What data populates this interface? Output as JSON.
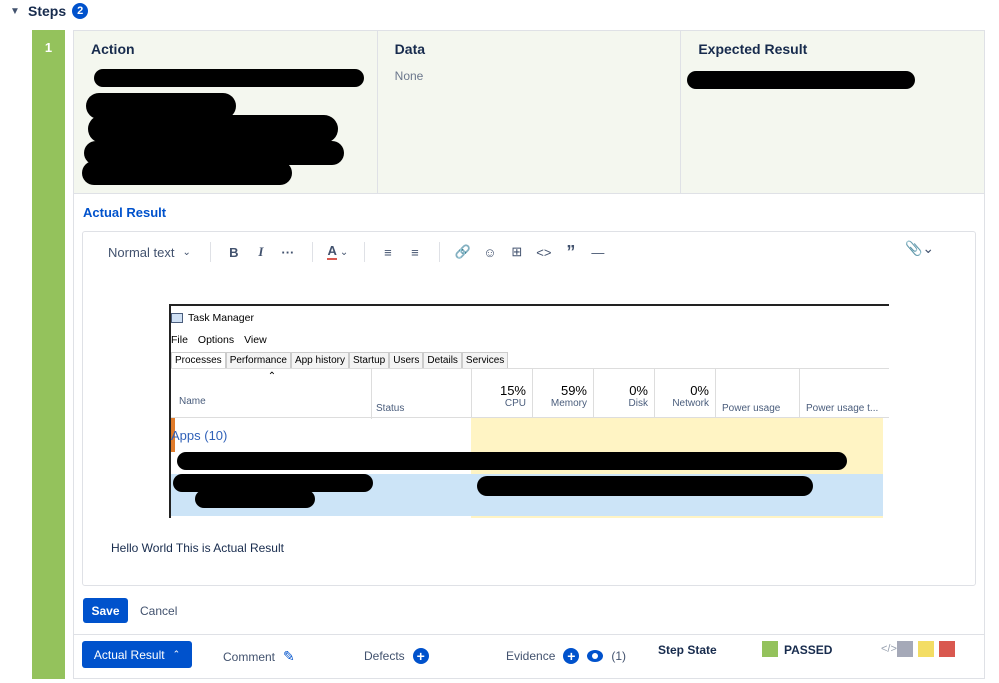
{
  "section": {
    "title": "Steps",
    "count": "2",
    "chevron_icon": "chevron-down-icon"
  },
  "step": {
    "number": "1",
    "columns": [
      {
        "header": "Action",
        "value": ""
      },
      {
        "header": "Data",
        "value": "None"
      },
      {
        "header": "Expected Result",
        "value": ""
      }
    ]
  },
  "actual_result": {
    "title": "Actual Result",
    "toolbar": {
      "text_style": "Normal text",
      "icons": [
        "bold-icon",
        "italic-icon",
        "more-formatting-icon",
        "text-color-icon",
        "bullet-list-icon",
        "numbered-list-icon",
        "link-icon",
        "emoji-icon",
        "table-icon",
        "code-icon",
        "quote-icon",
        "divider-icon",
        "attachment-icon"
      ],
      "bold_glyph": "B",
      "italic_glyph": "I",
      "more_glyph": "···",
      "text_color_glyph": "A"
    },
    "embedded_screenshot": {
      "window_title": "Task Manager",
      "menu": [
        "File",
        "Options",
        "View"
      ],
      "tabs": [
        "Processes",
        "Performance",
        "App history",
        "Startup",
        "Users",
        "Details",
        "Services"
      ],
      "columns": [
        {
          "label": "Name",
          "pct": ""
        },
        {
          "label": "Status",
          "pct": ""
        },
        {
          "label": "CPU",
          "pct": "15%"
        },
        {
          "label": "Memory",
          "pct": "59%"
        },
        {
          "label": "Disk",
          "pct": "0%"
        },
        {
          "label": "Network",
          "pct": "0%"
        },
        {
          "label": "Power usage",
          "pct": ""
        },
        {
          "label": "Power usage t...",
          "pct": ""
        }
      ],
      "group_label": "Apps (10)"
    },
    "body_text": "Hello World This is Actual Result",
    "save_label": "Save",
    "cancel_label": "Cancel"
  },
  "footer": {
    "actual_result_button": "Actual Result",
    "comment_label": "Comment",
    "defects_label": "Defects",
    "evidence_label": "Evidence",
    "evidence_count": "(1)",
    "step_state_label": "Step State",
    "step_state_value": "PASSED",
    "code_glyph": "</>",
    "colors": {
      "passed": "#94c25c",
      "gray": "#a5a9b8",
      "yellow": "#f3dd64",
      "red": "#d9584f",
      "primary": "#0052cc"
    }
  }
}
